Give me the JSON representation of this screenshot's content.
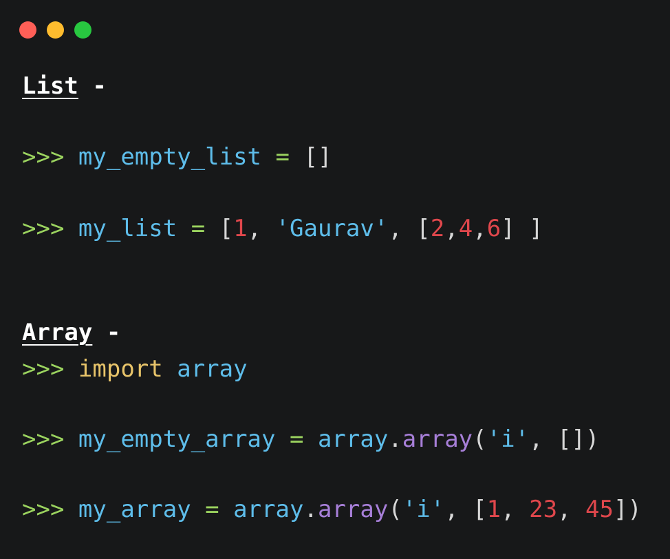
{
  "window_controls": {
    "close_color": "#ff5f57",
    "minimize_color": "#febc2e",
    "maximize_color": "#28c840"
  },
  "sections": {
    "list_heading": "List",
    "array_heading": "Array",
    "dash": "-"
  },
  "code": {
    "prompt": ">>>",
    "line1": {
      "ident": "my_empty_list",
      "op": "=",
      "value": "[]"
    },
    "line2": {
      "ident": "my_list",
      "op": "=",
      "open": "[",
      "n1": "1",
      "sep1": ", ",
      "s1": "'Gaurav'",
      "sep2": ", ",
      "inner_open": "[",
      "n2": "2",
      "c1": ",",
      "n3": "4",
      "c2": ",",
      "n4": "6",
      "inner_close": "]",
      "close": " ]"
    },
    "line3": {
      "kw": "import",
      "module": "array"
    },
    "line4": {
      "ident": "my_empty_array",
      "op": "=",
      "obj": "array",
      "dot": ".",
      "method": "array",
      "open": "(",
      "s1": "'i'",
      "rest": ", [])"
    },
    "line5": {
      "ident": "my_array",
      "op": "=",
      "obj": "array",
      "dot": ".",
      "method": "array",
      "open": "(",
      "s1": "'i'",
      "sep": ", [",
      "n1": "1",
      "c1": ", ",
      "n2": "23",
      "c2": ", ",
      "n3": "45",
      "close": "])"
    }
  }
}
